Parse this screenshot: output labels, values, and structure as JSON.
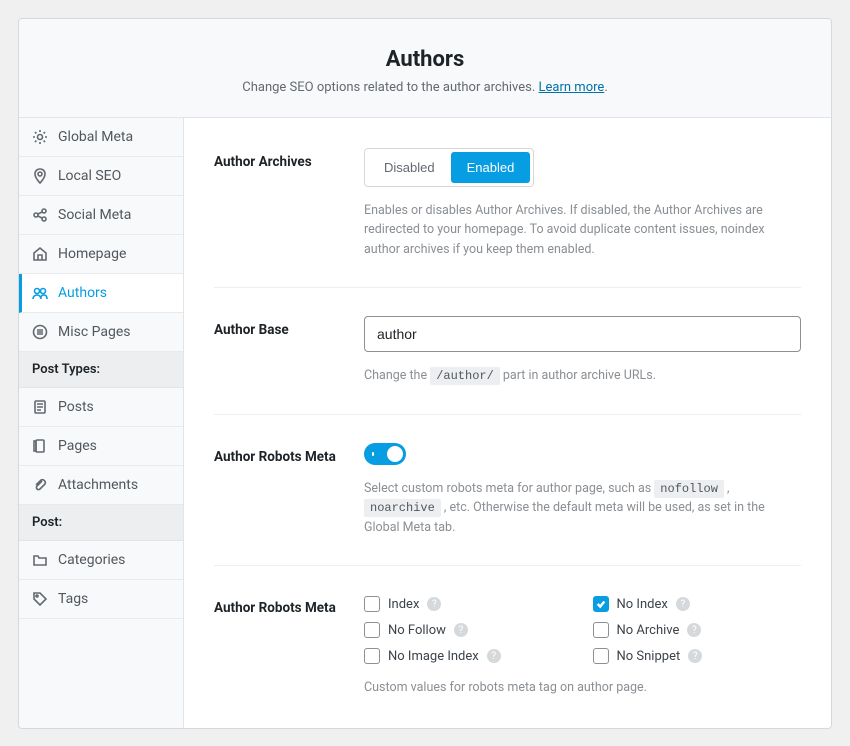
{
  "header": {
    "title": "Authors",
    "subtitle_pre": "Change SEO options related to the author archives. ",
    "learn_more": "Learn more",
    "subtitle_post": "."
  },
  "sidebar": {
    "items1": [
      {
        "id": "global-meta",
        "label": "Global Meta",
        "icon": "gear"
      },
      {
        "id": "local-seo",
        "label": "Local SEO",
        "icon": "pin"
      },
      {
        "id": "social-meta",
        "label": "Social Meta",
        "icon": "share"
      },
      {
        "id": "homepage",
        "label": "Homepage",
        "icon": "home"
      },
      {
        "id": "authors",
        "label": "Authors",
        "icon": "users",
        "active": true
      },
      {
        "id": "misc-pages",
        "label": "Misc Pages",
        "icon": "list"
      }
    ],
    "group1": "Post Types:",
    "items2": [
      {
        "id": "posts",
        "label": "Posts",
        "icon": "post"
      },
      {
        "id": "pages",
        "label": "Pages",
        "icon": "page"
      },
      {
        "id": "attachments",
        "label": "Attachments",
        "icon": "clip"
      }
    ],
    "group2": "Post:",
    "items3": [
      {
        "id": "categories",
        "label": "Categories",
        "icon": "folder"
      },
      {
        "id": "tags",
        "label": "Tags",
        "icon": "tag"
      }
    ]
  },
  "fields": {
    "archives": {
      "label": "Author Archives",
      "disabled": "Disabled",
      "enabled": "Enabled",
      "value": "enabled",
      "help": "Enables or disables Author Archives. If disabled, the Author Archives are redirected to your homepage. To avoid duplicate content issues, noindex author archives if you keep them enabled."
    },
    "base": {
      "label": "Author Base",
      "value": "author",
      "help_pre": "Change the ",
      "help_code": "/author/",
      "help_post": " part in author archive URLs."
    },
    "robots_toggle": {
      "label": "Author Robots Meta",
      "value": true,
      "help_pre": "Select custom robots meta for author page, such as ",
      "help_code1": "nofollow",
      "help_mid": " , ",
      "help_code2": "noarchive",
      "help_post": " , etc. Otherwise the default meta will be used, as set in the Global Meta tab."
    },
    "robots_meta": {
      "label": "Author Robots Meta",
      "options": [
        {
          "id": "index",
          "label": "Index",
          "checked": false
        },
        {
          "id": "noindex",
          "label": "No Index",
          "checked": true
        },
        {
          "id": "nofollow",
          "label": "No Follow",
          "checked": false
        },
        {
          "id": "noarchive",
          "label": "No Archive",
          "checked": false
        },
        {
          "id": "noimageindex",
          "label": "No Image Index",
          "checked": false
        },
        {
          "id": "nosnippet",
          "label": "No Snippet",
          "checked": false
        }
      ],
      "help": "Custom values for robots meta tag on author page."
    }
  }
}
